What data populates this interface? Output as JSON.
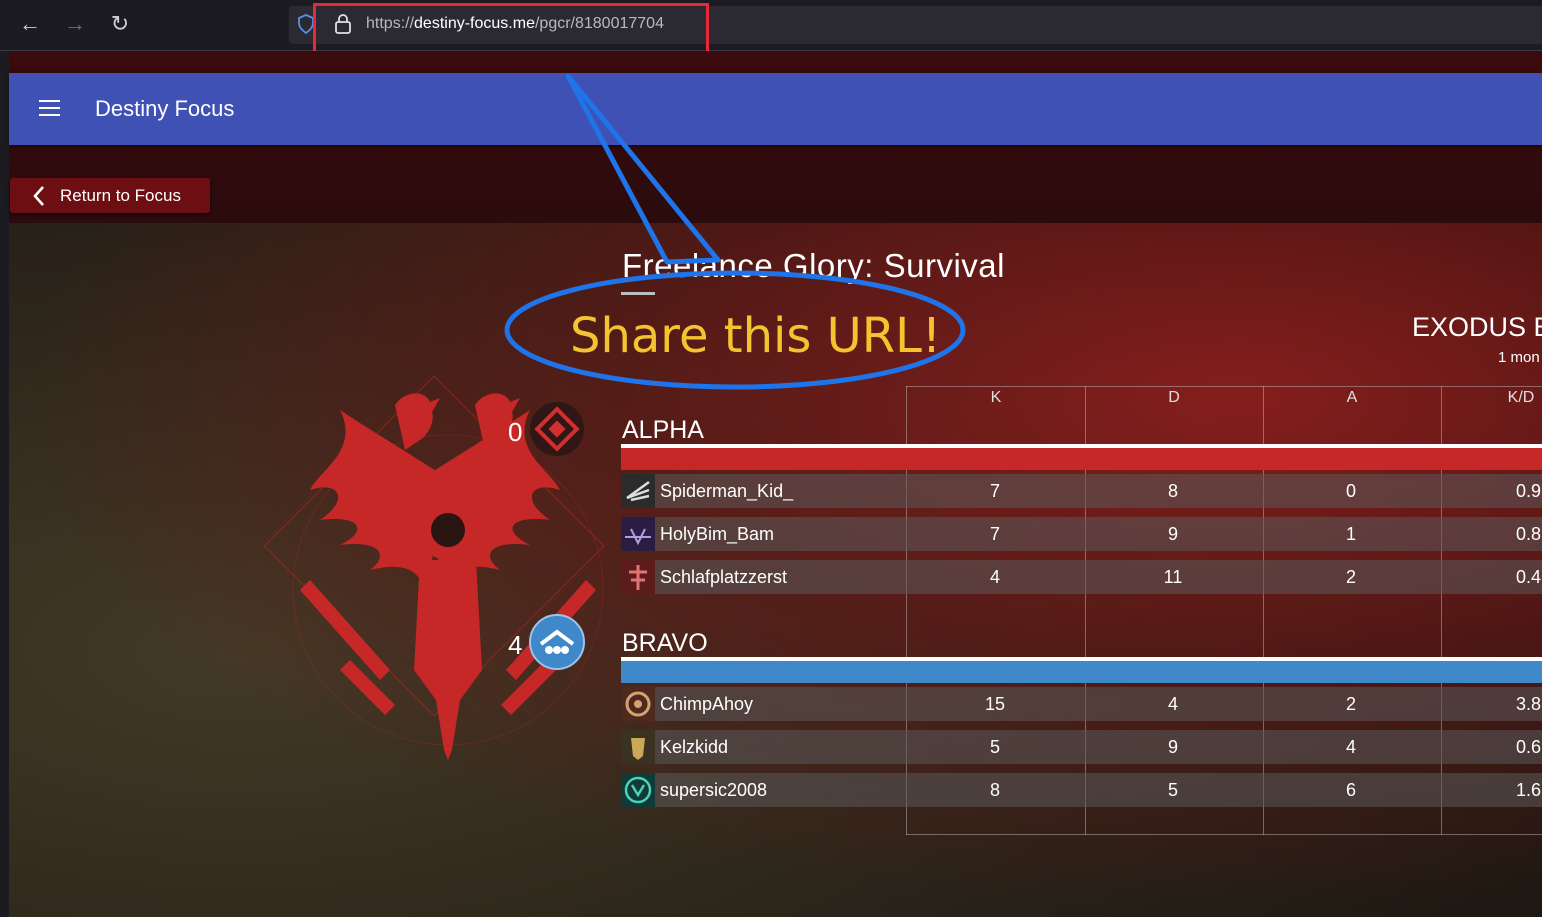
{
  "browser": {
    "url_scheme": "https://",
    "url_host": "destiny-focus.me",
    "url_path": "/pgcr/8180017704"
  },
  "app": {
    "title": "Destiny Focus",
    "return_label": "Return to Focus"
  },
  "match": {
    "mode": "Freelance Glory: Survival",
    "map": "EXODUS B",
    "time": "1 mon"
  },
  "annotation": {
    "text": "Share this URL!"
  },
  "table": {
    "columns": [
      "K",
      "D",
      "A",
      "K/D"
    ]
  },
  "teams": {
    "alpha": {
      "name": "ALPHA",
      "score": "0",
      "color": "#c62828",
      "players": [
        {
          "name": "Spiderman_Kid_",
          "k": "7",
          "d": "8",
          "a": "0",
          "kd": "0.9"
        },
        {
          "name": "HolyBim_Bam",
          "k": "7",
          "d": "9",
          "a": "1",
          "kd": "0.8"
        },
        {
          "name": "Schlafplatzzerst",
          "k": "4",
          "d": "11",
          "a": "2",
          "kd": "0.4"
        }
      ]
    },
    "bravo": {
      "name": "BRAVO",
      "score": "4",
      "color": "#3f88c9",
      "players": [
        {
          "name": "ChimpAhoy",
          "k": "15",
          "d": "4",
          "a": "2",
          "kd": "3.8"
        },
        {
          "name": "Kelzkidd",
          "k": "5",
          "d": "9",
          "a": "4",
          "kd": "0.6"
        },
        {
          "name": "supersic2008",
          "k": "8",
          "d": "5",
          "a": "6",
          "kd": "1.6"
        }
      ]
    }
  }
}
